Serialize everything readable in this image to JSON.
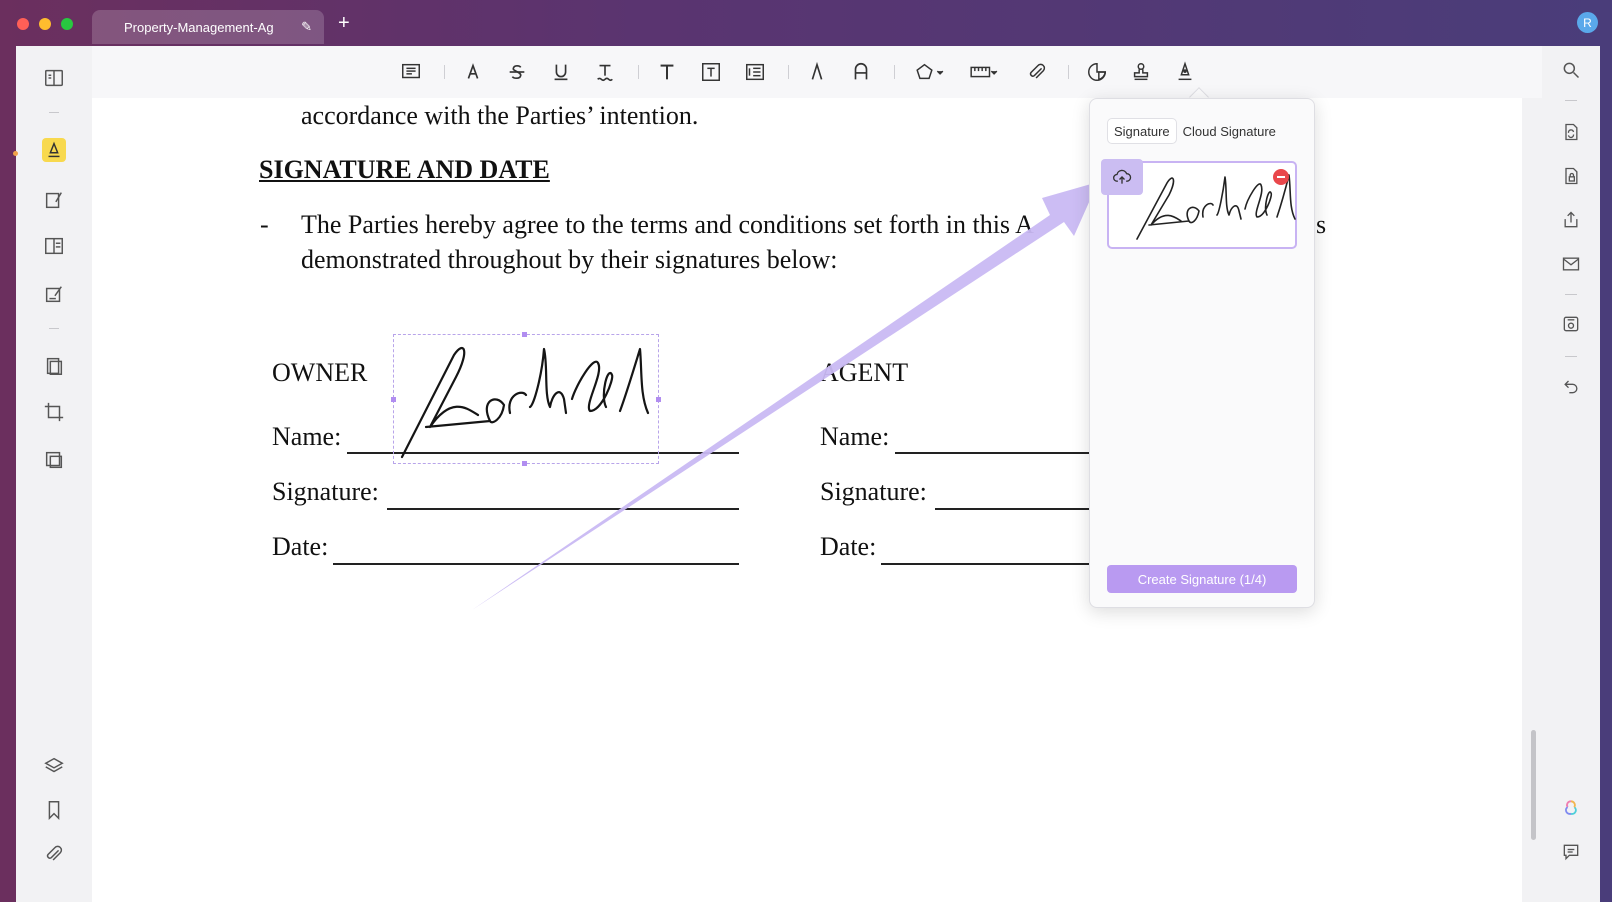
{
  "tab": {
    "title": "Property-Management-Ag",
    "add": "+"
  },
  "user": {
    "avatar_initial": "R"
  },
  "document": {
    "line1": "accordance with the Parties’ intention.",
    "heading": "SIGNATURE AND DATE",
    "dash": "-",
    "para1": "The Parties hereby agree to the terms and conditions set forth in this A",
    "para1_tail": "s",
    "para2": "demonstrated throughout by their signatures below:",
    "owner_label": "OWNER",
    "agent_label": "AGENT",
    "owner_name": "Name:",
    "owner_signature": "Signature:",
    "owner_date": "Date:",
    "agent_name": "Name:",
    "agent_signature": "Signature:",
    "agent_date": "Date:"
  },
  "signature_panel": {
    "tab_signature": "Signature",
    "tab_cloud": "Cloud Signature",
    "create_button": "Create Signature (1/4)"
  },
  "colors": {
    "accent": "#b99af1",
    "arrow": "#c9b9f3",
    "delete": "#e9474b",
    "highlight": "#f8d94e"
  }
}
